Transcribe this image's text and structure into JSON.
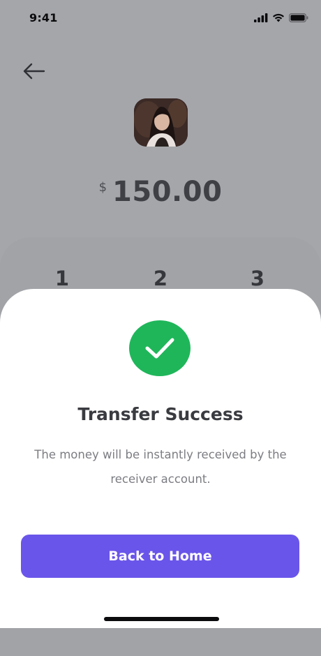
{
  "status_bar": {
    "time": "9:41"
  },
  "icons": {
    "back": "arrow-left-icon",
    "signal": "cellular-signal-icon",
    "wifi": "wifi-icon",
    "battery": "battery-icon",
    "success": "checkmark-icon"
  },
  "transfer": {
    "currency_symbol": "$",
    "amount": "150.00"
  },
  "keypad": {
    "keys": [
      "1",
      "2",
      "3"
    ]
  },
  "sheet": {
    "title": "Transfer Success",
    "message": "The money will be instantly received by the receiver account.",
    "button_label": "Back to Home"
  },
  "colors": {
    "success_green": "#1fb65a",
    "primary_purple": "#6a55ea",
    "overlay_gray": "#a5a6aa"
  }
}
